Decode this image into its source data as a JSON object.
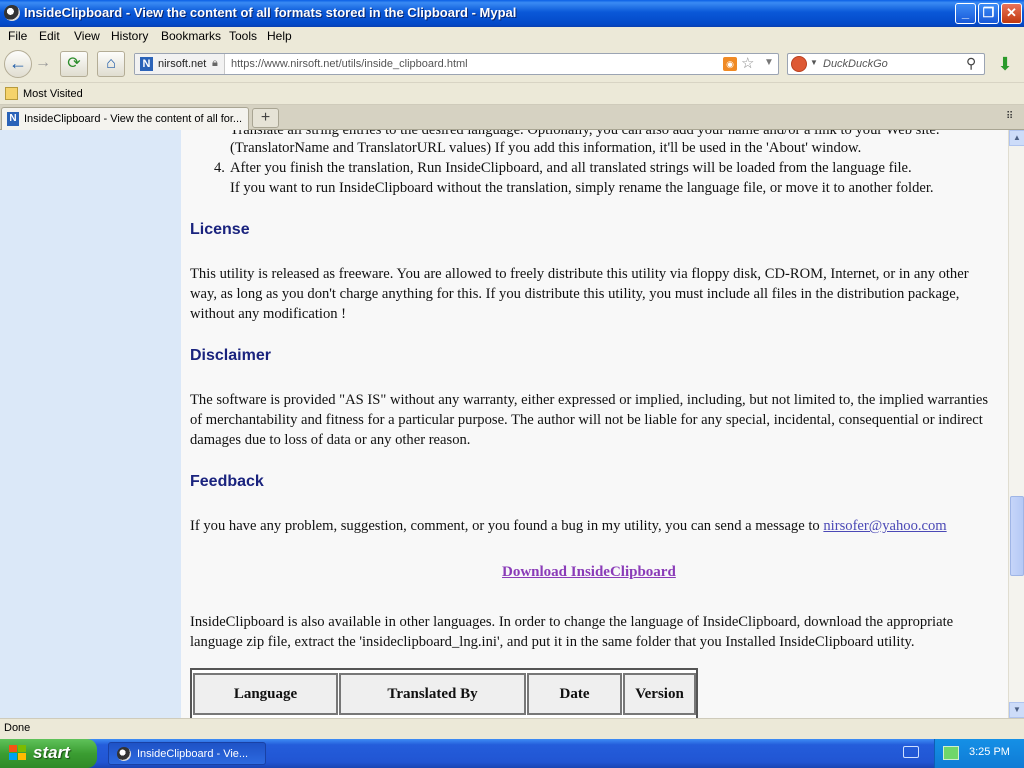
{
  "window": {
    "title": "InsideClipboard - View the content of all formats stored in the Clipboard - Mypal",
    "minimize_glyph": "_",
    "maximize_glyph": "❐",
    "close_glyph": "✕"
  },
  "menu": [
    "File",
    "Edit",
    "View",
    "History",
    "Bookmarks",
    "Tools",
    "Help"
  ],
  "navbar": {
    "back_glyph": "←",
    "forward_glyph": "→",
    "reload_glyph": "⟳",
    "home_glyph": "⌂",
    "site_identity": "nirsoft.net",
    "favicon_letter": "N",
    "url": "https://www.nirsoft.net/utils/inside_clipboard.html",
    "search_placeholder": "DuckDuckGo",
    "download_glyph": "⬇"
  },
  "bookmarks": {
    "most_visited": "Most Visited"
  },
  "tabs": {
    "active_label": "InsideClipboard - View the content of all for...",
    "new_tab_glyph": "+",
    "list_glyph": "⠿"
  },
  "content": {
    "partial_top_line": "Translate all string entries to the desired language. Optionally, you can also add your name and/or a link to your Web site.",
    "item3_line2": "(TranslatorName and TranslatorURL values) If you add this information, it'll be used in the 'About' window.",
    "item4_number": "4.",
    "item4_line1": "After you finish the translation, Run InsideClipboard, and all translated strings will be loaded from the language file.",
    "item4_line2": "If you want to run InsideClipboard without the translation, simply rename the language file, or move it to another folder.",
    "license_heading": "License",
    "license_text": "This utility is released as freeware. You are allowed to freely distribute this utility via floppy disk, CD-ROM, Internet, or in any other way, as long as you don't charge anything for this. If you distribute this utility, you must include all files in the distribution package, without any modification !",
    "disclaimer_heading": "Disclaimer",
    "disclaimer_text": "The software is provided \"AS IS\" without any warranty, either expressed or implied, including, but not limited to, the implied warranties of merchantability and fitness for a particular purpose. The author will not be liable for any special, incidental, consequential or indirect damages due to loss of data or any other reason.",
    "feedback_heading": "Feedback",
    "feedback_text": "If you have any problem, suggestion, comment, or you found a bug in my utility, you can send a message to",
    "feedback_email": "nirsofer@yahoo.com",
    "download_link": "Download InsideClipboard",
    "languages_text": "InsideClipboard is also available in other languages. In order to change the language of InsideClipboard, download the appropriate language zip file, extract the 'insideclipboard_lng.ini', and put it in the same folder that you Installed InsideClipboard utility.",
    "table_headers": [
      "Language",
      "Translated By",
      "Date",
      "Version"
    ]
  },
  "statusbar": {
    "text": "Done"
  },
  "taskbar": {
    "start_label": "start",
    "task_label": "InsideClipboard - Vie...",
    "clock": "3:25 PM"
  }
}
